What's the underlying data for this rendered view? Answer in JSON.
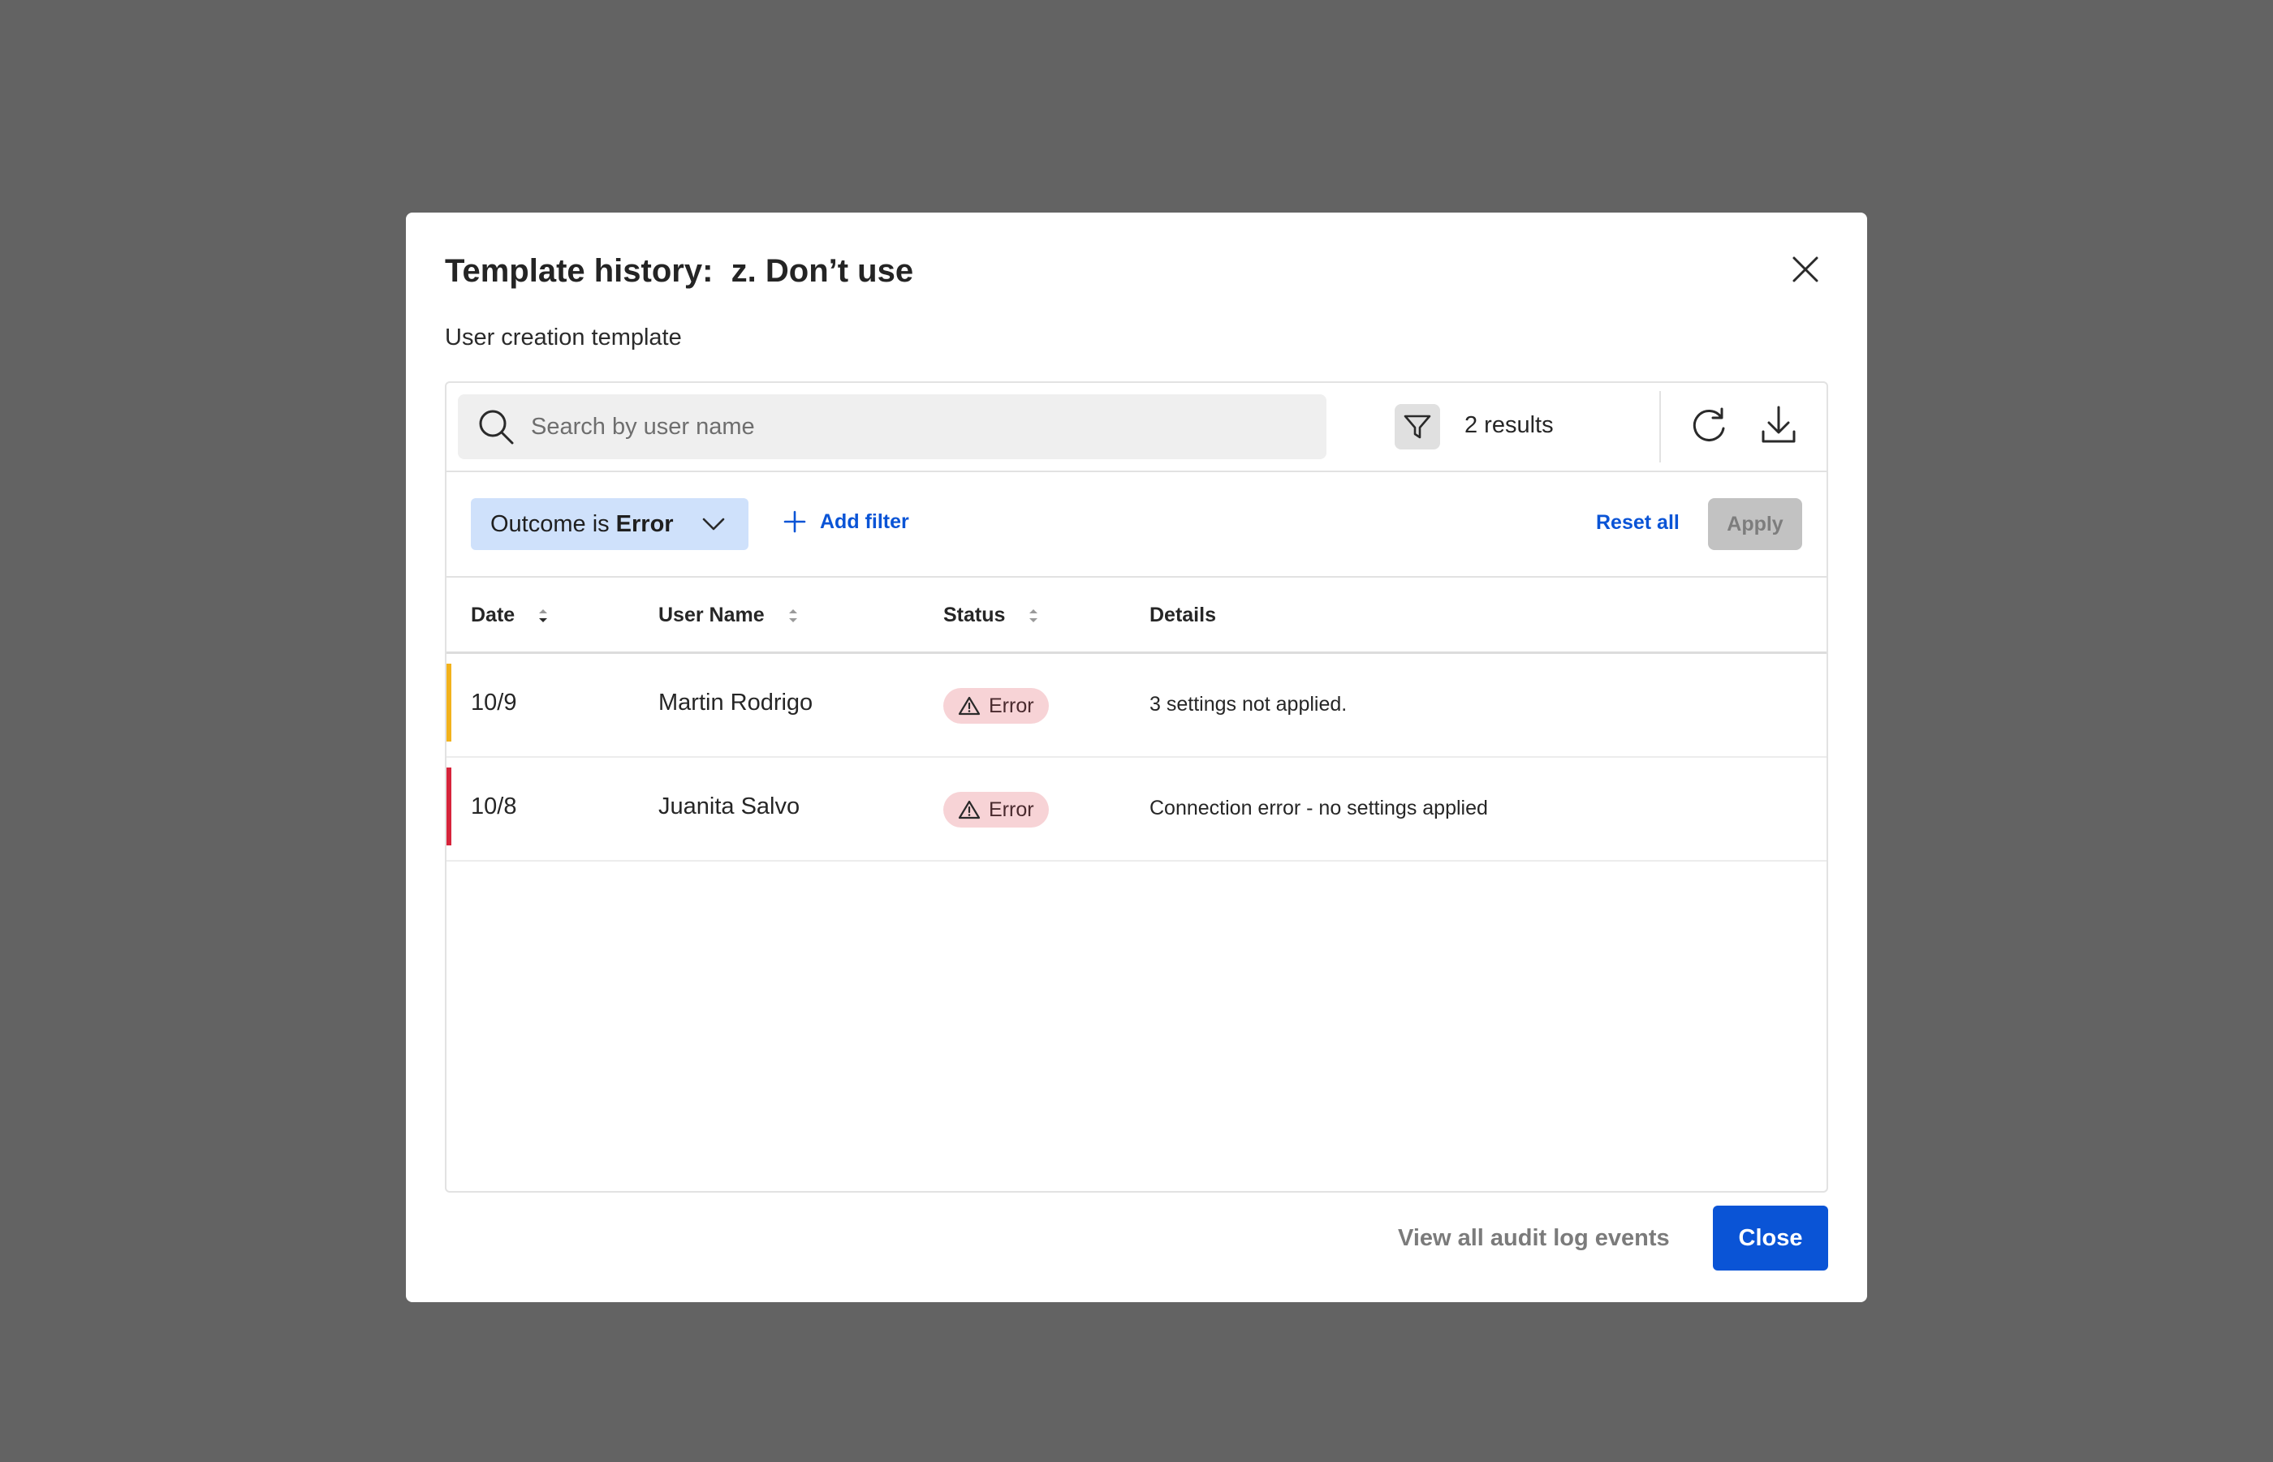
{
  "dialog": {
    "title": "Template history:  z. Don’t use",
    "subtitle": "User creation template"
  },
  "toolbar": {
    "search_placeholder": "Search by user name",
    "search_value": "",
    "results_text": "2 results",
    "icons": [
      "search-icon",
      "filter-icon",
      "refresh-icon",
      "download-icon"
    ]
  },
  "filters": {
    "chip_prefix": "Outcome is",
    "chip_value": "Error",
    "add_filter_label": "Add filter",
    "reset_label": "Reset all",
    "apply_label": "Apply"
  },
  "table": {
    "columns": [
      "Date",
      "User Name",
      "Status",
      "Details"
    ],
    "rows": [
      {
        "date": "10/9",
        "user": "Martin Rodrigo",
        "status": "Error",
        "details": "3 settings not applied.",
        "severity_color": "#f2b21c"
      },
      {
        "date": "10/8",
        "user": "Juanita Salvo",
        "status": "Error",
        "details": "Connection error - no settings applied",
        "severity_color": "#d6243b"
      }
    ]
  },
  "footer": {
    "audit_link": "View all audit log events",
    "close_label": "Close"
  },
  "colors": {
    "accent": "#0a54d6",
    "chip_bg": "#cfe1fb",
    "error_badge_bg": "#f7d3d6",
    "overlay": "#636363"
  }
}
